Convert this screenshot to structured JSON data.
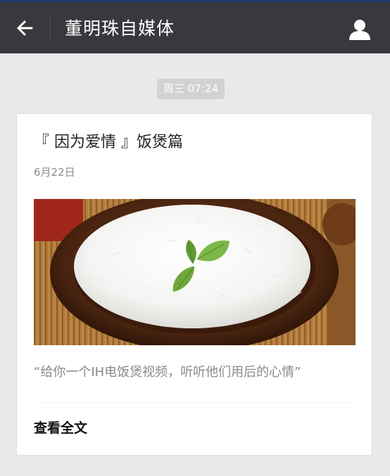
{
  "header": {
    "title": "董明珠自媒体",
    "back_icon": "back-arrow-icon",
    "profile_icon": "person-icon",
    "background": "#38393d"
  },
  "timestamp": "周三 07:24",
  "article": {
    "title": "『 因为爱情 』饭煲篇",
    "date": "6月22日",
    "image": "bowl-of-white-rice-with-basil-leaves",
    "description": "“给你一个IH电饭煲视频，听听他们用后的心情”",
    "read_more": "查看全文"
  }
}
